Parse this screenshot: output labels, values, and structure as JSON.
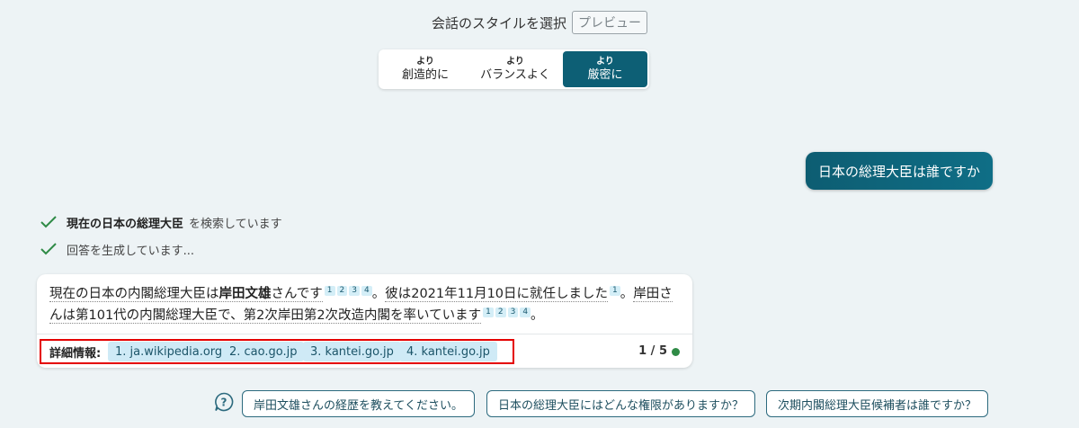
{
  "header": {
    "label": "会話のスタイルを選択",
    "badge": "プレビュー"
  },
  "tone": {
    "options": [
      {
        "small": "より",
        "big": "創造的に"
      },
      {
        "small": "より",
        "big": "バランスよく"
      },
      {
        "small": "より",
        "big": "厳密に"
      }
    ],
    "selected": "厳密に"
  },
  "user_message": "日本の総理大臣は誰ですか",
  "steps": [
    {
      "bold": "現在の日本の総理大臣",
      "text": "を検索しています"
    },
    {
      "bold": "",
      "text": "回答を生成しています..."
    }
  ],
  "answer": {
    "segments": {
      "s1": "現在の日本の内閣総理大臣は",
      "s1b": "岸田文雄",
      "s1c": "さんです",
      "s2": "。",
      "s3": "彼は2021年11月10日に就任しました",
      "s4": "。",
      "s5": "岸田さんは第101代の内閣総理大臣で、第2次岸田第2次改造内閣を率いています",
      "s6": "。"
    },
    "cite": {
      "c1": "1",
      "c2": "2",
      "c3": "3",
      "c4": "4"
    },
    "details_label": "詳細情報:",
    "sources": [
      "1. ja.wikipedia.org",
      "2. cao.go.jp",
      "3. kantei.go.jp",
      "4. kantei.go.jp"
    ],
    "page_count": "1 / 5"
  },
  "suggestions": [
    "岸田文雄さんの経歴を教えてください。",
    "日本の総理大臣にはどんな権限がありますか？",
    "次期内閣総理大臣候補者は誰ですか？"
  ],
  "colors": {
    "accent": "#0d5f75",
    "highlight": "#e40000",
    "status_dot": "#2f8b46",
    "chip_bg": "#cfeaf6"
  }
}
